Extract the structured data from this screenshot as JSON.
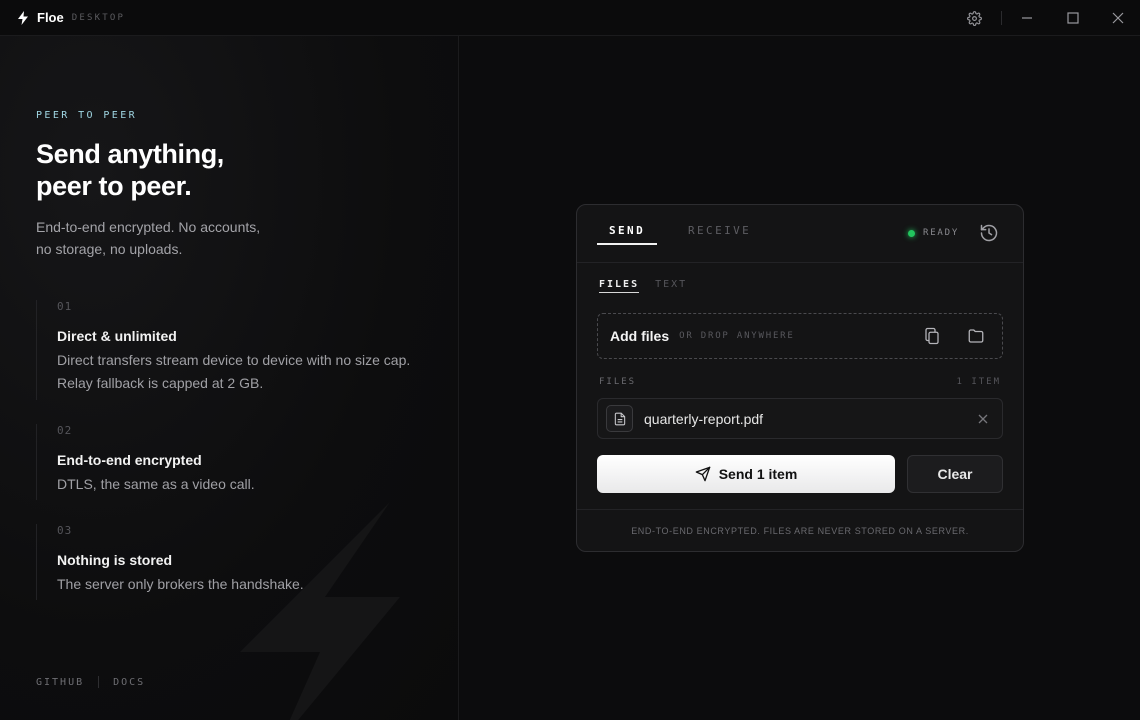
{
  "titlebar": {
    "app_name": "Floe",
    "app_sub": "DESKTOP",
    "icons": [
      "bolt-icon",
      "gear-icon",
      "minimize-icon",
      "maximize-icon",
      "close-icon"
    ]
  },
  "hero": {
    "eyebrow": "PEER TO PEER",
    "title_line1": "Send anything,",
    "title_line2": "peer to peer.",
    "lede_line1": "End-to-end encrypted. No accounts,",
    "lede_line2": "no storage, no uploads."
  },
  "features": [
    {
      "num": "01",
      "title": "Direct & unlimited",
      "desc_line1": "Direct transfers stream device to device with no size cap.",
      "desc_line2": "Relay fallback is capped at 2 GB."
    },
    {
      "num": "02",
      "title": "End-to-end encrypted",
      "desc_line1": "DTLS, the same as a video call.",
      "desc_line2": ""
    },
    {
      "num": "03",
      "title": "Nothing is stored",
      "desc_line1": "The server only brokers the handshake.",
      "desc_line2": ""
    }
  ],
  "footer": {
    "github": "GITHUB",
    "docs": "DOCS"
  },
  "card": {
    "tabs": {
      "send": "SEND",
      "receive": "RECEIVE",
      "active": "send"
    },
    "status": {
      "text": "READY",
      "color": "#22c55e"
    },
    "subtabs": {
      "files": "FILES",
      "text": "TEXT",
      "active": "files"
    },
    "dropzone": {
      "title": "Add files",
      "hint": "OR DROP ANYWHERE"
    },
    "files_label": "FILES",
    "files_count": "1 ITEM",
    "files": [
      {
        "name": "quarterly-report.pdf",
        "icon": "document-icon"
      }
    ],
    "send_label": "Send 1 item",
    "clear_label": "Clear",
    "footer_note": "END-TO-END ENCRYPTED. FILES ARE NEVER STORED ON A SERVER."
  }
}
